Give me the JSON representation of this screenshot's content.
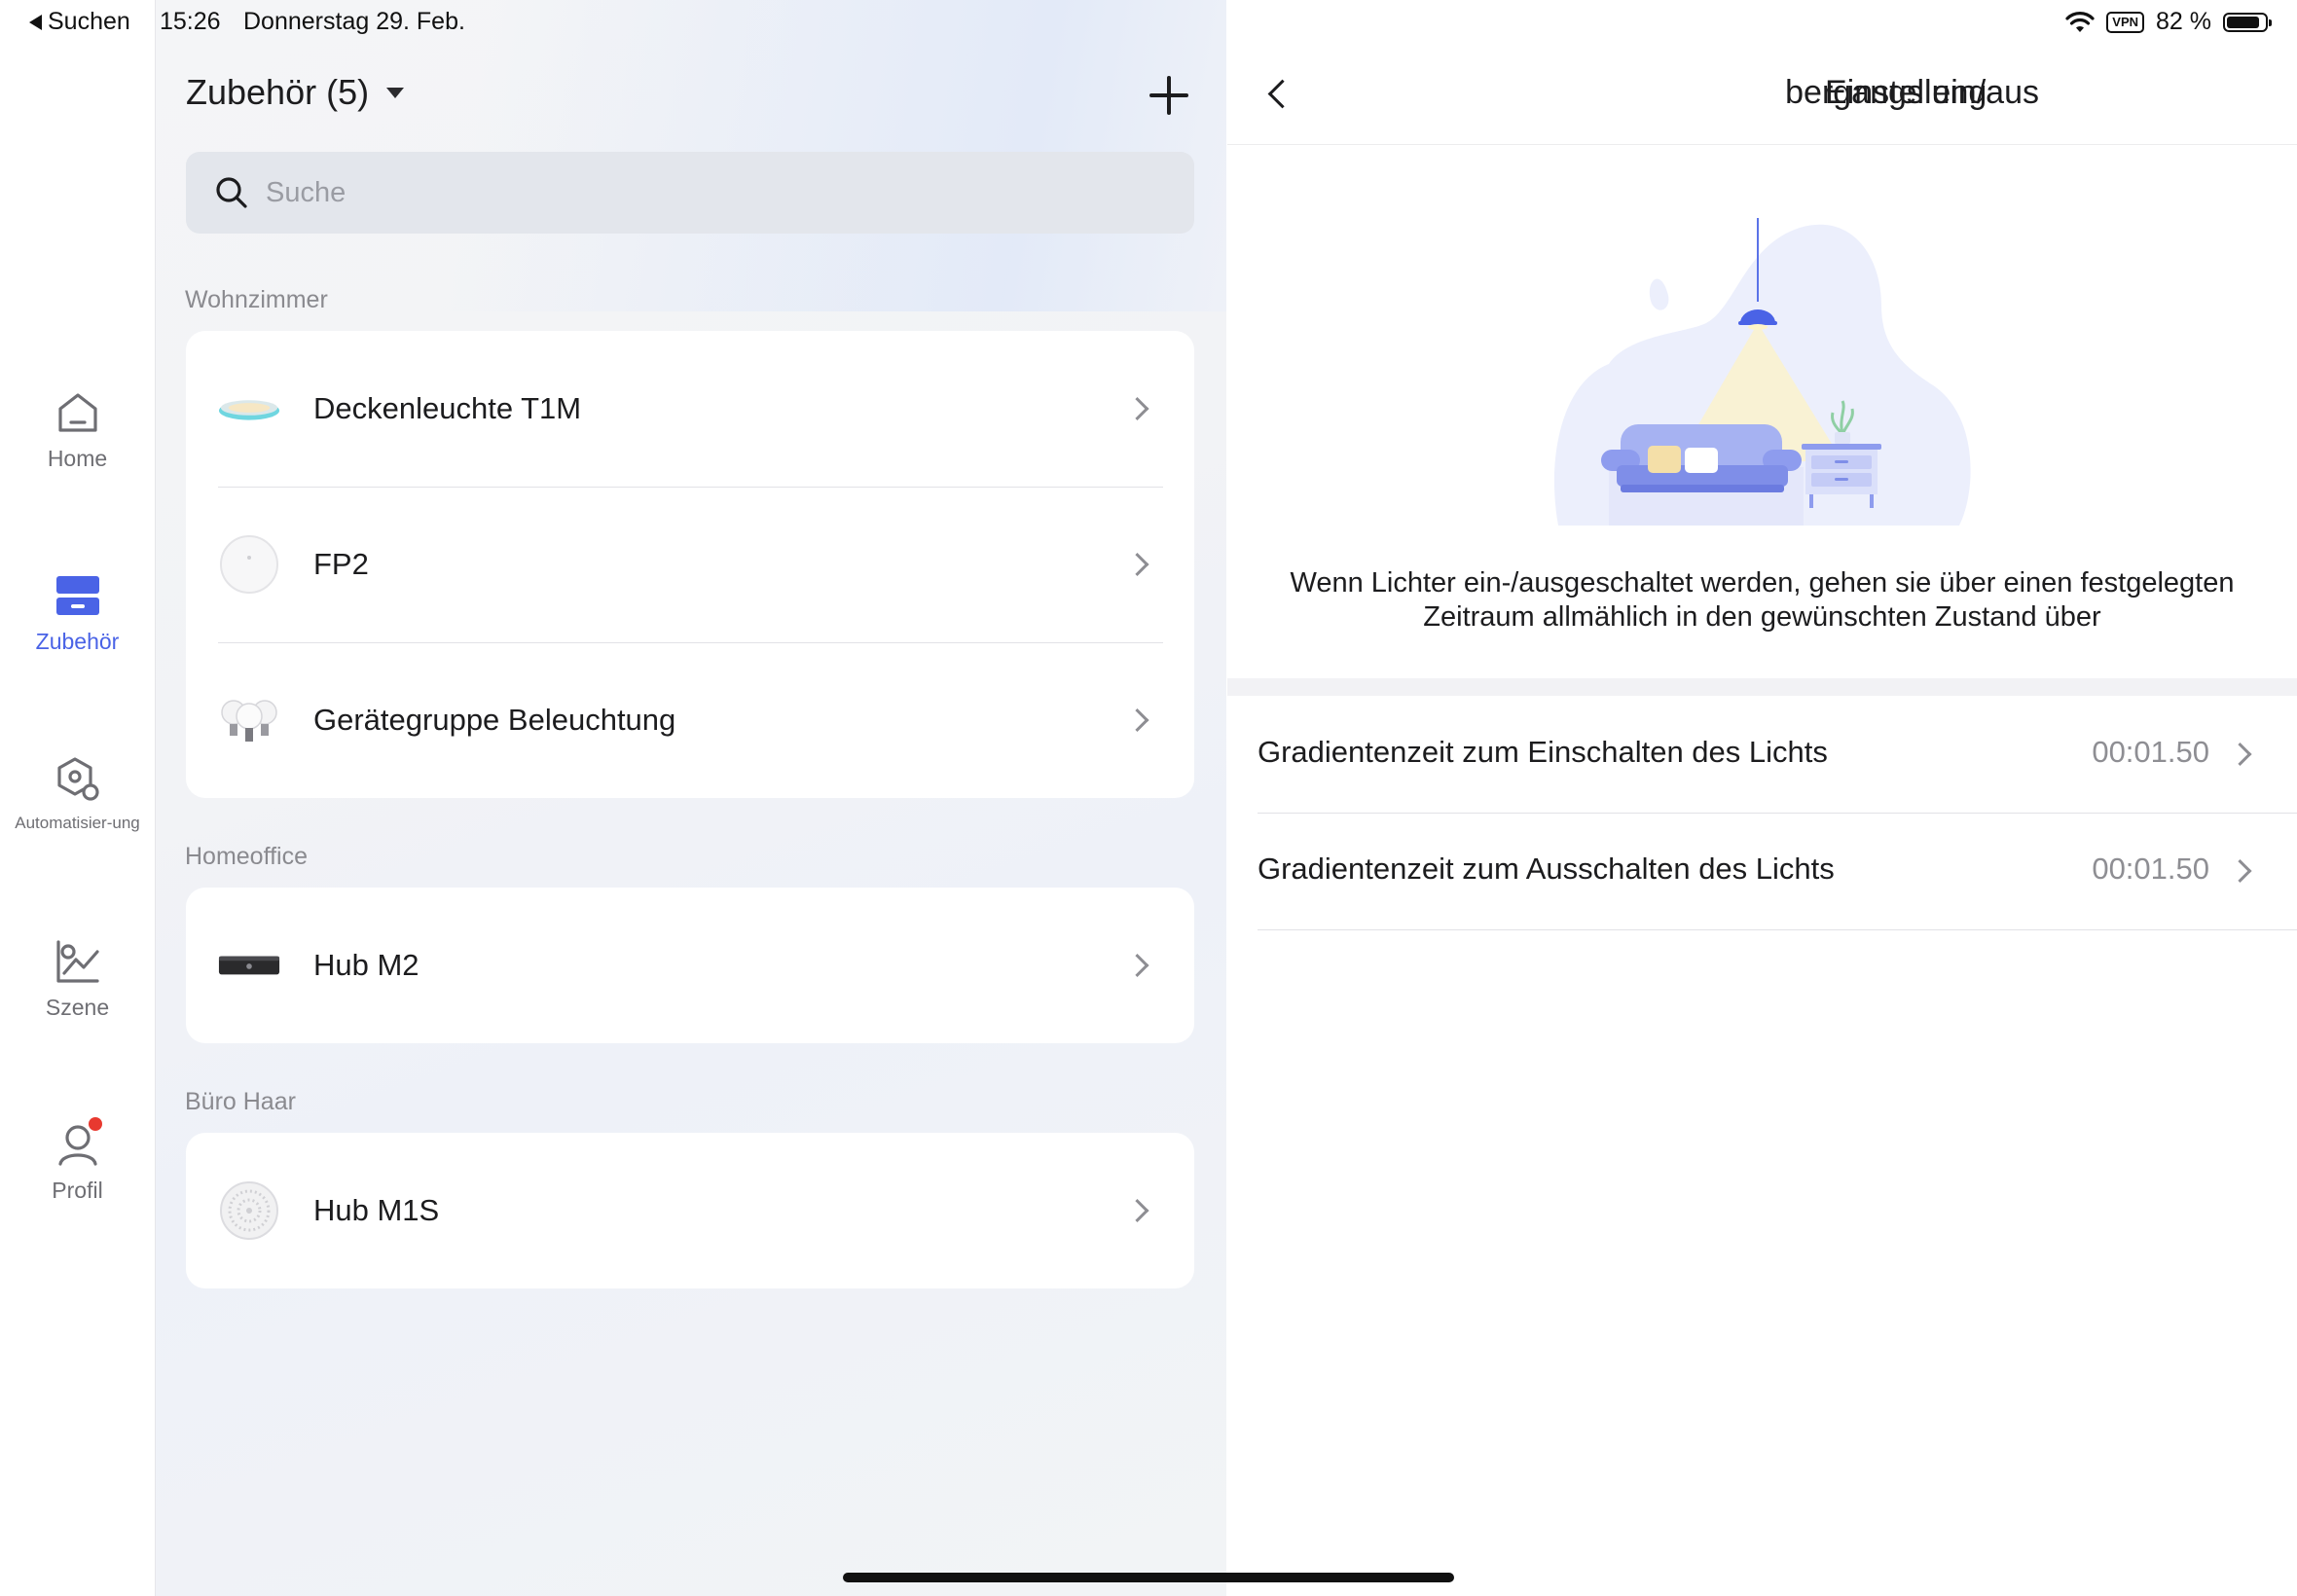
{
  "status_bar": {
    "back_label": "Suchen",
    "time": "15:26",
    "date": "Donnerstag 29. Feb.",
    "vpn": "VPN",
    "battery": "82 %",
    "battery_level": 0.82
  },
  "tabs": [
    {
      "label": "Home",
      "icon": "home-icon"
    },
    {
      "label": "Zubehör",
      "icon": "accessories-icon",
      "active": true
    },
    {
      "label": "Automatisier-ung",
      "icon": "automation-icon"
    },
    {
      "label": "Szene",
      "icon": "scene-icon"
    },
    {
      "label": "Profil",
      "icon": "profile-icon",
      "badge": true
    }
  ],
  "middle": {
    "title": "Zubehör (5)",
    "search_placeholder": "Suche",
    "sections": [
      {
        "name": "Wohnzimmer",
        "items": [
          {
            "name": "Deckenleuchte T1M",
            "icon": "ceiling-light-icon"
          },
          {
            "name": "FP2",
            "icon": "presence-sensor-icon"
          },
          {
            "name": "Gerätegruppe Beleuchtung",
            "icon": "bulb-group-icon"
          }
        ]
      },
      {
        "name": "Homeoffice",
        "items": [
          {
            "name": "Hub M2",
            "icon": "hub-m2-icon"
          }
        ]
      },
      {
        "name": "Büro Haar",
        "items": [
          {
            "name": "Hub M1S",
            "icon": "hub-m1s-icon"
          }
        ]
      }
    ]
  },
  "right": {
    "title_fragment": "bergangs ein/aus",
    "tab": "Einstellung",
    "description_line1": "Wenn Lichter ein-/ausgeschaltet werden, gehen sie über einen festgelegten",
    "description_line2": "Zeitraum allmählich in den gewünschten Zustand über",
    "settings": [
      {
        "label": "Gradientenzeit zum Einschalten des Lichts",
        "value": "00:01.50"
      },
      {
        "label": "Gradientenzeit zum Ausschalten des Lichts",
        "value": "00:01.50"
      }
    ]
  },
  "colors": {
    "accent": "#4a63e6",
    "badge": "#e8392f",
    "secondary_text": "#8e8e93"
  }
}
